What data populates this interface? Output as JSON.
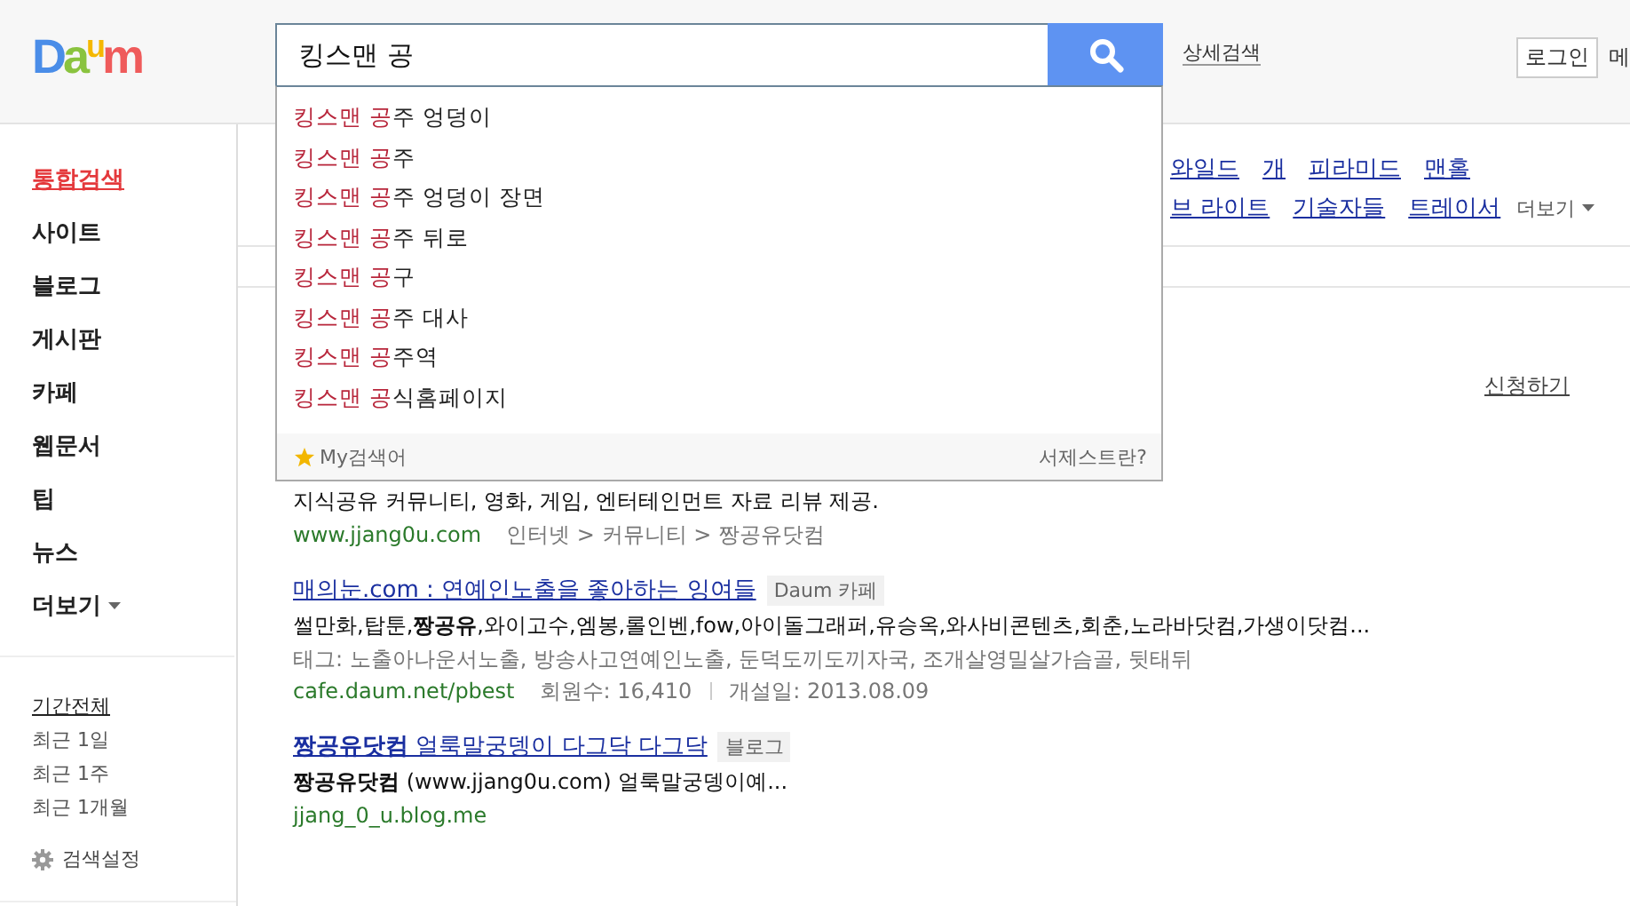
{
  "header": {
    "logo": "Da$^{u}$m",
    "search": {
      "value": "킹스맨 공"
    },
    "advanced_link": "상세검색",
    "login_button": "로그인",
    "edge_text": "메"
  },
  "suggestions": [
    {
      "match": "킹스맨 공",
      "rest": "주 엉덩이"
    },
    {
      "match": "킹스맨 공",
      "rest": "주"
    },
    {
      "match": "킹스맨 공",
      "rest": "주 엉덩이 장면"
    },
    {
      "match": "킹스맨 공",
      "rest": "주 뒤로"
    },
    {
      "match": "킹스맨 공",
      "rest": "구"
    },
    {
      "match": "킹스맨 공",
      "rest": "주 대사"
    },
    {
      "match": "킹스맨 공",
      "rest": "주역"
    },
    {
      "match": "킹스맨 공",
      "rest": "식홈페이지"
    }
  ],
  "suggest_footer": {
    "my_searches": "My검색어",
    "help": "서제스트란?"
  },
  "sidebar": {
    "items": [
      {
        "label": "통합검색",
        "selected": true
      },
      {
        "label": "사이트",
        "selected": false
      },
      {
        "label": "블로그",
        "selected": false
      },
      {
        "label": "게시판",
        "selected": false
      },
      {
        "label": "카페",
        "selected": false
      },
      {
        "label": "웹문서",
        "selected": false
      },
      {
        "label": "팁",
        "selected": false
      },
      {
        "label": "뉴스",
        "selected": false
      }
    ],
    "more": "더보기",
    "periods": [
      {
        "label": "기간전체",
        "selected": true
      },
      {
        "label": "최근 1일",
        "selected": false
      },
      {
        "label": "최근 1주",
        "selected": false
      },
      {
        "label": "최근 1개월",
        "selected": false
      }
    ],
    "settings": "검색설정"
  },
  "related": {
    "first_line": [
      "와일드",
      "개",
      "피라미드",
      "맨홀"
    ],
    "second_line": [
      "브 라이트",
      "기술자들",
      "트레이서"
    ],
    "more": "더보기"
  },
  "apply_link": "신청하기",
  "results": [
    {
      "desc": "지식공유 커뮤니티, 영화, 게임, 엔터테인먼트 자료 리뷰 제공.",
      "url": "www.jjang0u.com",
      "meta": [
        "인터넷 > 커뮤니티 > 짱공유닷컴"
      ]
    },
    {
      "title": "매의눈.com : 연예인노출을 좋아하는 잉여들",
      "tag": "Daum 카페",
      "desc": "썰만화,탑툰,**짱공유**,와이고수,엠봉,롤인벤,fow,아이돌그래퍼,유승옥,와사비콘텐츠,회춘,노라바닷컴,가생이닷컴...",
      "tags": "태그: 노출아나운서노출, 방송사고연예인노출, 둔덕도끼도끼자국, 조개살영밀살가슴골, 뒷태뒤",
      "url": "cafe.daum.net/pbest",
      "meta": [
        "회원수: 16,410",
        "개설일: 2013.08.09"
      ]
    },
    {
      "title": "**짱공유닷컴** 얼룩말궁뎅이 다그닥 다그닥",
      "tag": "블로그",
      "desc": "**짱공유닷컴** (www.jjang0u.com) 얼룩말궁뎅이예...",
      "url": "jjang_0_u.blog.me"
    }
  ]
}
